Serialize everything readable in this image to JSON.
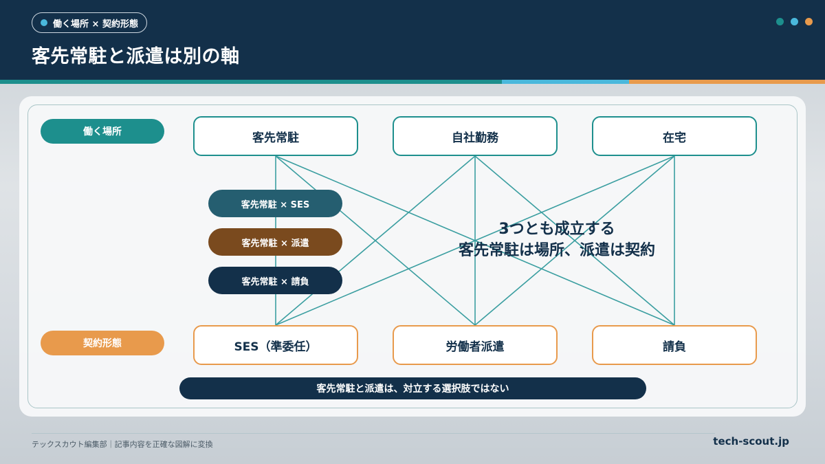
{
  "header": {
    "tag": "働く場所 × 契約形態",
    "title": "客先常駐と派遣は別の軸"
  },
  "colors": {
    "navy": "#13304a",
    "teal": "#1d8f8d",
    "orange": "#e89a4c",
    "sky": "#4ab8dc",
    "brown": "#7a4a1e",
    "slate": "#255e70"
  },
  "rows": {
    "place_label": "働く場所",
    "contract_label": "契約形態"
  },
  "places": [
    "客先常駐",
    "自社勤務",
    "在宅"
  ],
  "contracts": [
    "SES（準委任）",
    "労働者派遣",
    "請負"
  ],
  "combos": [
    "客先常駐 × SES",
    "客先常駐 × 派遣",
    "客先常駐 × 請負"
  ],
  "center": {
    "line1": "3つとも成立する",
    "line2": "客先常駐は場所、派遣は契約"
  },
  "banner": "客先常駐と派遣は、対立する選択肢ではない",
  "footer": {
    "left": "テックスカウト編集部｜記事内容を正確な図解に変換",
    "right": "tech-scout.jp"
  }
}
